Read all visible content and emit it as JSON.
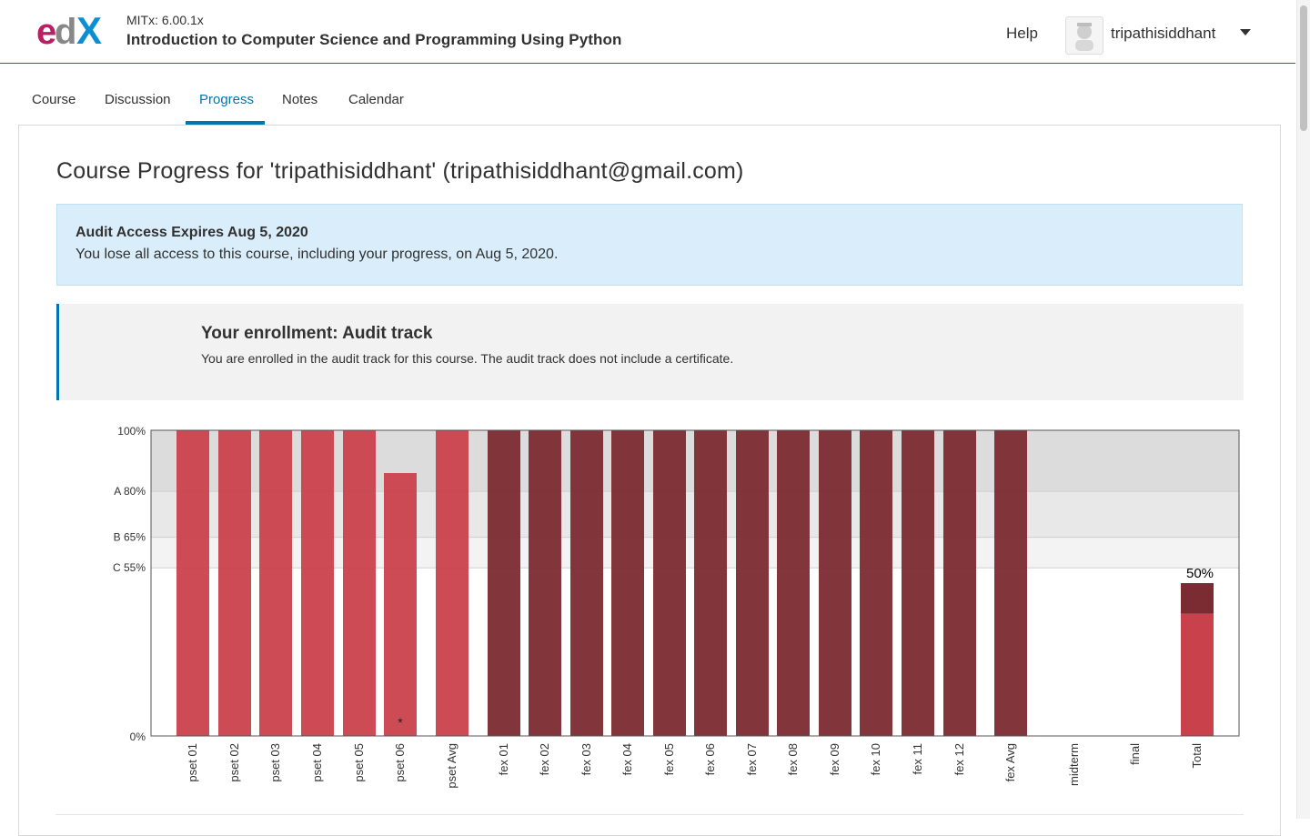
{
  "header": {
    "course_org": "MITx: 6.00.1x",
    "course_name": "Introduction to Computer Science and Programming Using Python",
    "help_label": "Help",
    "username": "tripathisiddhant",
    "logo_icon": "edx-logo",
    "avatar_icon": "user-avatar-icon"
  },
  "tabs": [
    {
      "label": "Course"
    },
    {
      "label": "Discussion"
    },
    {
      "label": "Progress",
      "active": true
    },
    {
      "label": "Notes"
    },
    {
      "label": "Calendar"
    }
  ],
  "page_title": "Course Progress for 'tripathisiddhant' (tripathisiddhant@gmail.com)",
  "audit": {
    "title": "Audit Access Expires Aug 5, 2020",
    "body": "You lose all access to this course, including your progress, on Aug 5, 2020."
  },
  "enrollment": {
    "title": "Your enrollment: Audit track",
    "body": "You are enrolled in the audit track for this course. The audit track does not include a certificate."
  },
  "colors": {
    "accent": "#0075b4",
    "pset_bar": "#c9414b",
    "fex_bar": "#7b2b32",
    "grade_band": "#dcdcdc"
  },
  "chart_data": {
    "type": "bar",
    "categories": [
      "pset 01",
      "pset 02",
      "pset 03",
      "pset 04",
      "pset 05",
      "pset 06",
      "pset Avg",
      "fex 01",
      "fex 02",
      "fex 03",
      "fex 04",
      "fex 05",
      "fex 06",
      "fex 07",
      "fex 08",
      "fex 09",
      "fex 10",
      "fex 11",
      "fex 12",
      "fex Avg",
      "midterm",
      "final",
      "Total"
    ],
    "series": [
      {
        "values": [
          100,
          100,
          100,
          100,
          100,
          86,
          100,
          null,
          null,
          null,
          null,
          null,
          null,
          null,
          null,
          null,
          null,
          null,
          null,
          null,
          0,
          0,
          40
        ],
        "color": "#c9414b"
      },
      {
        "values": [
          null,
          null,
          null,
          null,
          null,
          null,
          null,
          100,
          100,
          100,
          100,
          100,
          100,
          100,
          100,
          100,
          100,
          100,
          100,
          100,
          0,
          0,
          10
        ],
        "color": "#7b2b32"
      }
    ],
    "stacked_total": true,
    "dropped_marker": {
      "category": "pset 06",
      "symbol": "*"
    },
    "total_label": "50%",
    "grade_cutoffs": [
      {
        "label": "A 80%",
        "value": 80
      },
      {
        "label": "B 65%",
        "value": 65
      },
      {
        "label": "C 55%",
        "value": 55
      }
    ],
    "y_ticks": [
      {
        "label": "100%",
        "value": 100
      },
      {
        "label": "0%",
        "value": 0
      }
    ],
    "ylim": [
      0,
      100
    ]
  }
}
